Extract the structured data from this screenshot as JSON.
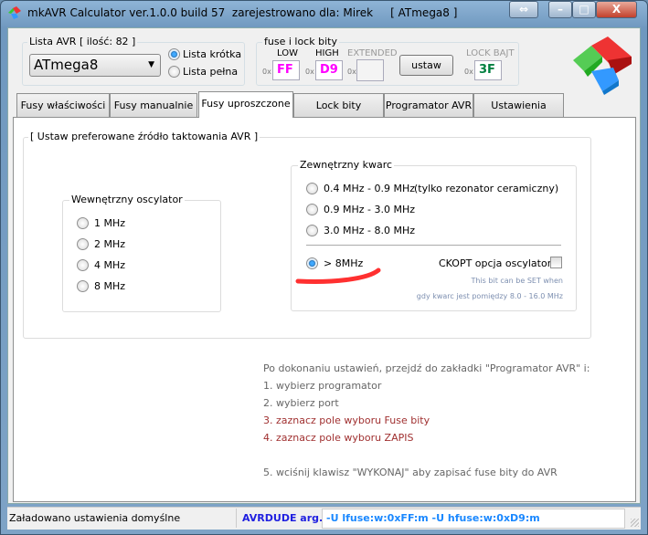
{
  "window": {
    "title": "mkAVR Calculator ver.1.0.0 build 57  zarejestrowano dla: Mirek     [ ATmega8 ]",
    "buttons": {
      "resize": "⇔",
      "minimize": "–",
      "maximize": "□",
      "close": "X"
    }
  },
  "avr_list": {
    "label": "Lista AVR [ ilość: 82 ]",
    "selected": "ATmega8",
    "options": [
      {
        "label": "Lista krótka",
        "checked": true
      },
      {
        "label": "Lista pełna",
        "checked": false
      }
    ]
  },
  "fuses": {
    "label": "fuse i lock bity",
    "low_label": "LOW",
    "low": "FF",
    "high_label": "HIGH",
    "high": "D9",
    "ext_label": "EXTENDED",
    "ext": "",
    "prefix": "0x",
    "set_button": "ustaw",
    "lock_label": "LOCK BAJT",
    "lock": "3F",
    "colors": {
      "fuse": "#ff00ff",
      "lock": "#008040"
    }
  },
  "tabs": [
    "Fusy właściwości",
    "Fusy manualnie",
    "Fusy uproszczone",
    "Lock bity",
    "Programator AVR",
    "Ustawienia"
  ],
  "active_tab": 2,
  "main": {
    "group_label": "[ Ustaw preferowane źródło taktowania AVR ]",
    "internal": {
      "label": "Wewnętrzny oscylator",
      "options": [
        "1 MHz",
        "2 MHz",
        "4 MHz",
        "8 MHz"
      ]
    },
    "external": {
      "label": "Zewnętrzny kwarc",
      "options": [
        "0.4 MHz - 0.9 MHz",
        "0.9 MHz - 3.0 MHz",
        "3.0 MHz - 8.0 MHz",
        "> 8MHz"
      ],
      "note0": "(tylko rezonator ceramiczny)",
      "selected": "> 8MHz",
      "ckopt_label": "CKOPT opcja oscylatora",
      "ckopt_checked": false,
      "hint1": "This bit can be SET when",
      "hint2": "gdy kwarc jest pomiędzy 8.0 - 16.0 MHz"
    },
    "instructions": [
      "Po dokonaniu ustawień, przejdź do zakładki \"Programator AVR\" i:",
      "1. wybierz programator",
      "2. wybierz port",
      "3. zaznacz pole wyboru Fuse bity",
      "4. zaznacz pole wyboru ZAPIS",
      "5. wciśnij klawisz \"WYKONAJ\" aby zapisać fuse bity do AVR"
    ]
  },
  "status": {
    "message": "Załadowano ustawienia domyślne",
    "avrdude_label": "AVRDUDE arg.",
    "avrdude_value": "-U lfuse:w:0xFF:m  -U hfuse:w:0xD9:m"
  }
}
